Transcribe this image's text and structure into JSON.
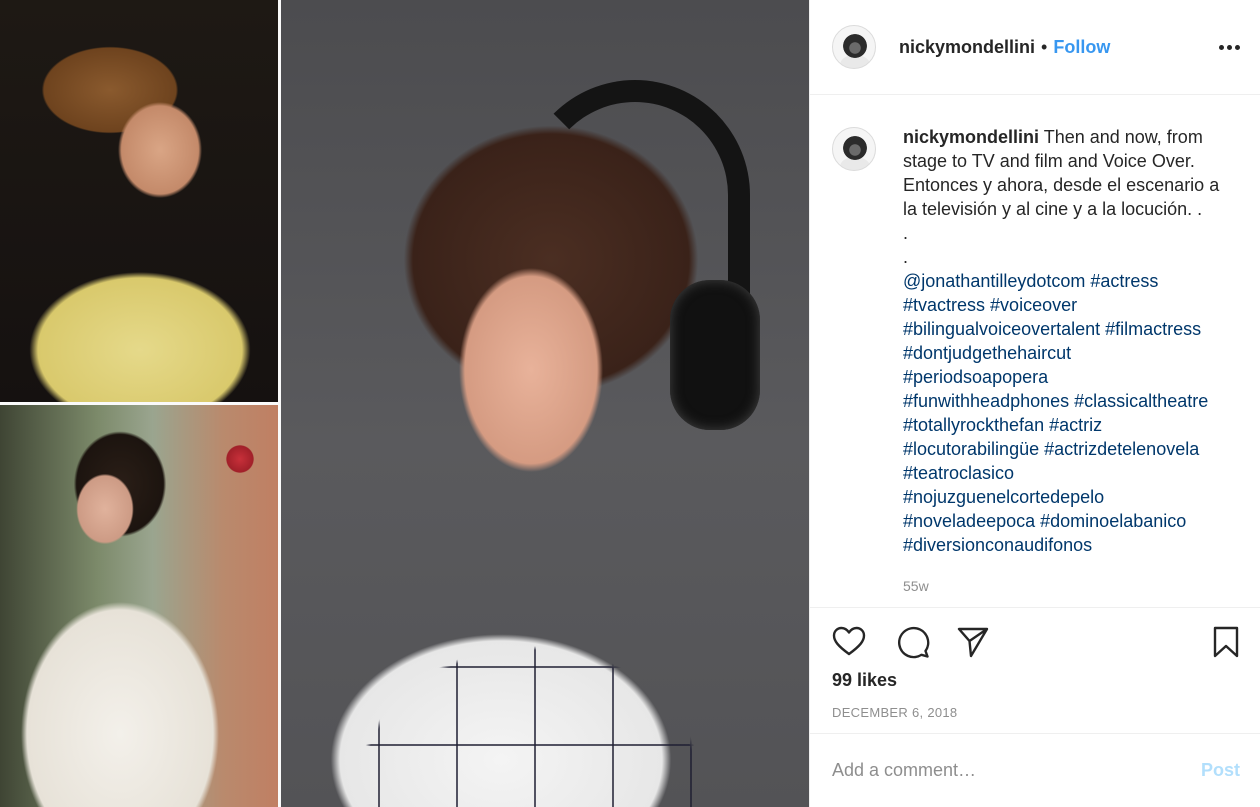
{
  "header": {
    "username": "nickymondellini",
    "separator": "•",
    "follow_label": "Follow",
    "more_icon": "more-horizontal-icon"
  },
  "caption": {
    "username": "nickymondellini",
    "text_lines": [
      "Then and now, from",
      "stage to TV and film and Voice Over.",
      "Entonces y ahora, desde el escenario a",
      "la televisión y al cine y a la locución. .",
      ".",
      "."
    ],
    "tag_lines": [
      [
        "@jonathantilleydotcom",
        "#actress"
      ],
      [
        "#tvactress",
        "#voiceover"
      ],
      [
        "#bilingualvoiceovertalent",
        "#filmactress"
      ],
      [
        "#dontjudgethehaircut"
      ],
      [
        "#periodsoapopera"
      ],
      [
        "#funwithheadphones",
        "#classicaltheatre"
      ],
      [
        "#totallyrockthefan",
        "#actriz"
      ],
      [
        "#locutorabilingüe",
        "#actrizdetelenovela"
      ],
      [
        "#teatroclasico"
      ],
      [
        "#nojuzguenelcortedepelo"
      ],
      [
        "#noveladeepoca",
        "#dominoelabanico"
      ],
      [
        "#diversionconaudifonos"
      ]
    ],
    "time_ago": "55w"
  },
  "actions": {
    "like_icon": "heart-icon",
    "comment_icon": "comment-icon",
    "share_icon": "share-icon",
    "save_icon": "bookmark-icon"
  },
  "likes": "99 likes",
  "date": "DECEMBER 6, 2018",
  "comment_box": {
    "placeholder": "Add a comment…",
    "post_label": "Post"
  },
  "colors": {
    "link": "#3897f0",
    "hashtag": "#00376b",
    "muted": "#8e8e8e",
    "post_disabled": "#b2dffc"
  }
}
